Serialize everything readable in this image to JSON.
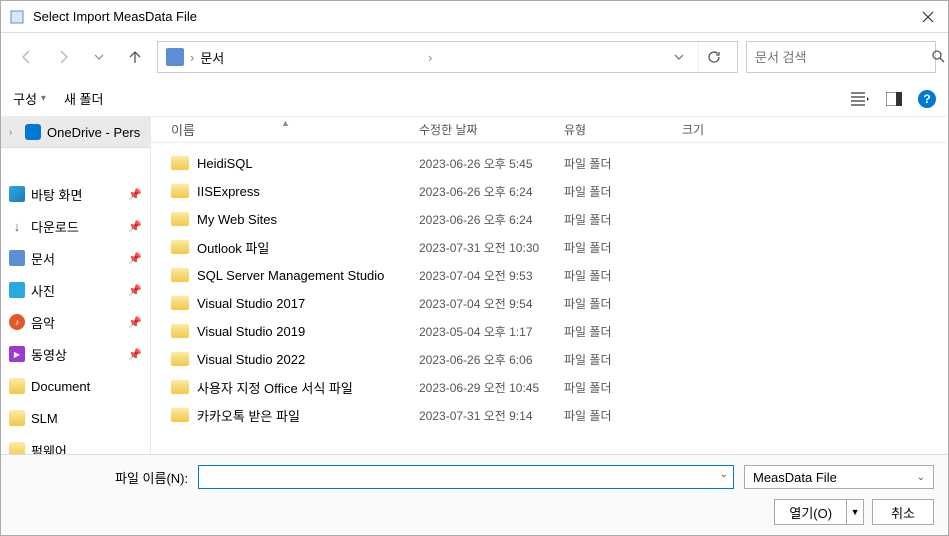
{
  "window": {
    "title": "Select Import MeasData File"
  },
  "address": {
    "segment": "문서",
    "chevron": "›"
  },
  "search": {
    "placeholder": "문서 검색"
  },
  "toolbar": {
    "organize": "구성",
    "new_folder": "새 폴더"
  },
  "sidebar": {
    "onedrive": "OneDrive - Pers",
    "items": [
      {
        "label": "바탕 화면",
        "pin": true,
        "icon": "desktop"
      },
      {
        "label": "다운로드",
        "pin": true,
        "icon": "download"
      },
      {
        "label": "문서",
        "pin": true,
        "icon": "docs"
      },
      {
        "label": "사진",
        "pin": true,
        "icon": "pics"
      },
      {
        "label": "음악",
        "pin": true,
        "icon": "music"
      },
      {
        "label": "동영상",
        "pin": true,
        "icon": "video"
      },
      {
        "label": "Document",
        "pin": false,
        "icon": "folder"
      },
      {
        "label": "SLM",
        "pin": false,
        "icon": "folder"
      },
      {
        "label": "펌웨어",
        "pin": false,
        "icon": "folder"
      }
    ]
  },
  "columns": {
    "name": "이름",
    "date": "수정한 날짜",
    "type": "유형",
    "size": "크기"
  },
  "files": [
    {
      "name": "HeidiSQL",
      "date": "2023-06-26 오후 5:45",
      "type": "파일 폴더"
    },
    {
      "name": "IISExpress",
      "date": "2023-06-26 오후 6:24",
      "type": "파일 폴더"
    },
    {
      "name": "My Web Sites",
      "date": "2023-06-26 오후 6:24",
      "type": "파일 폴더"
    },
    {
      "name": "Outlook 파일",
      "date": "2023-07-31 오전 10:30",
      "type": "파일 폴더"
    },
    {
      "name": "SQL Server Management Studio",
      "date": "2023-07-04 오전 9:53",
      "type": "파일 폴더"
    },
    {
      "name": "Visual Studio 2017",
      "date": "2023-07-04 오전 9:54",
      "type": "파일 폴더"
    },
    {
      "name": "Visual Studio 2019",
      "date": "2023-05-04 오후 1:17",
      "type": "파일 폴더"
    },
    {
      "name": "Visual Studio 2022",
      "date": "2023-06-26 오후 6:06",
      "type": "파일 폴더"
    },
    {
      "name": "사용자 지정 Office 서식 파일",
      "date": "2023-06-29 오전 10:45",
      "type": "파일 폴더"
    },
    {
      "name": "카카오톡 받은 파일",
      "date": "2023-07-31 오전 9:14",
      "type": "파일 폴더"
    }
  ],
  "footer": {
    "filename_label": "파일 이름(N):",
    "filename_value": "",
    "filter": "MeasData File",
    "open": "열기(O)",
    "cancel": "취소"
  }
}
